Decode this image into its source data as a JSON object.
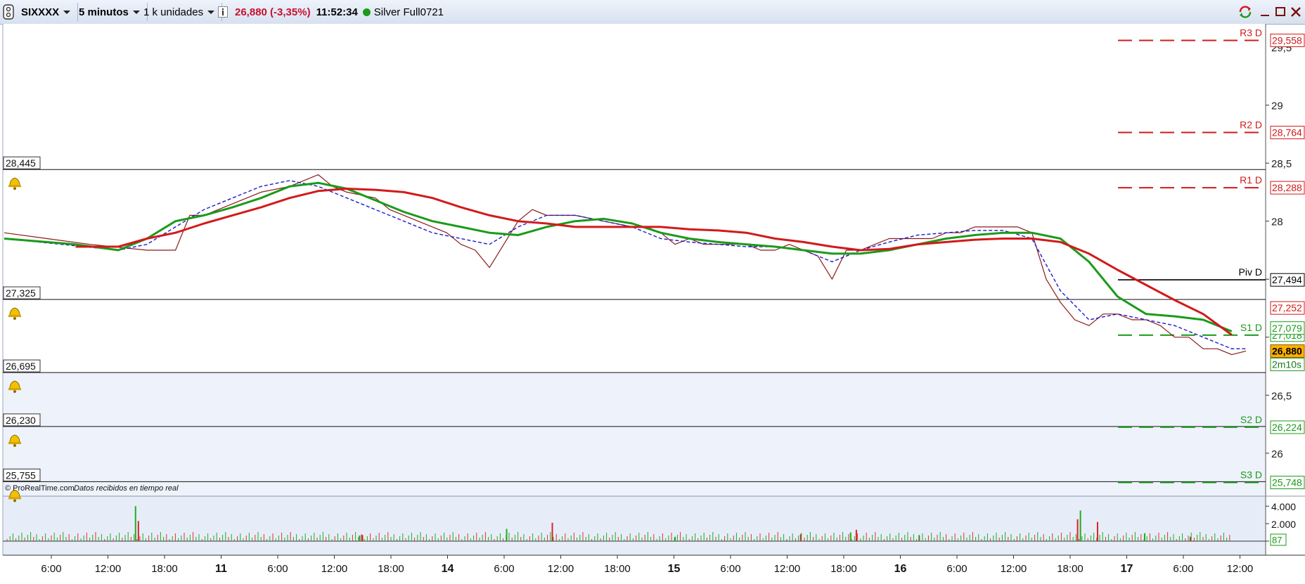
{
  "toolbar": {
    "symbol": "SIXXXX",
    "timeframe": "5 minutos",
    "units": "1 k unidades",
    "info_icon": "info-icon",
    "price_change": "26,880 (-3,35%)",
    "time": "11:52:34",
    "status_dot_color": "#1a9b1a",
    "feed": "Silver Full0721",
    "window_icons": [
      "refresh-icon",
      "minimize-icon",
      "maximize-icon",
      "close-icon"
    ]
  },
  "chart_data": {
    "type": "line",
    "credit": "© ProRealTime.com",
    "credit_note": "Datos recibidos en tiempo real",
    "y_axis": {
      "ticks": [
        26,
        26.5,
        27,
        27.5,
        28,
        28.5,
        29
      ],
      "tick_labels": [
        "26",
        "26,5",
        "27",
        "27,5",
        "28",
        "28,5",
        "29"
      ],
      "top_label": "29,5"
    },
    "x_axis": {
      "labels": [
        "6:00",
        "12:00",
        "18:00",
        "11",
        "6:00",
        "12:00",
        "18:00",
        "14",
        "6:00",
        "12:00",
        "18:00",
        "15",
        "6:00",
        "12:00",
        "18:00",
        "16",
        "6:00",
        "12:00",
        "18:00",
        "17",
        "6:00",
        "12:00"
      ],
      "bold": [
        false,
        false,
        false,
        true,
        false,
        false,
        false,
        true,
        false,
        false,
        false,
        true,
        false,
        false,
        false,
        true,
        false,
        false,
        false,
        true,
        false,
        false
      ]
    },
    "alert_levels": [
      {
        "label": "28,445",
        "value": 28.445
      },
      {
        "label": "27,325",
        "value": 27.325
      },
      {
        "label": "26,695",
        "value": 26.695
      },
      {
        "label": "26,230",
        "value": 26.23
      },
      {
        "label": "25,755",
        "value": 25.755
      }
    ],
    "pivots": [
      {
        "name": "R3 D",
        "tag": "29,558",
        "value": 29.558,
        "color": "#d21a1a",
        "style": "dashed"
      },
      {
        "name": "R2 D",
        "tag": "28,764",
        "value": 28.764,
        "color": "#d21a1a",
        "style": "dashed"
      },
      {
        "name": "R1 D",
        "tag": "28,288",
        "value": 28.288,
        "color": "#d21a1a",
        "style": "dashed"
      },
      {
        "name": "Piv D",
        "tag": "27,494",
        "value": 27.494,
        "color": "#000000",
        "style": "solid"
      },
      {
        "name": "S1 D",
        "tag": "27,018",
        "value": 27.018,
        "color": "#1a9b1a",
        "style": "dashed"
      },
      {
        "name": "S2 D",
        "tag": "26,224",
        "value": 26.224,
        "color": "#1a9b1a",
        "style": "dashed"
      },
      {
        "name": "S3 D",
        "tag": "25,748",
        "value": 25.748,
        "color": "#1a9b1a",
        "style": "dashed"
      }
    ],
    "axis_tags": [
      {
        "text": "27,252",
        "value": 27.252,
        "color": "#d21a1a"
      },
      {
        "text": "27,079",
        "value": 27.079,
        "color": "#1a9b1a"
      }
    ],
    "last_price": {
      "text": "26,880",
      "value": 26.88,
      "countdown": "2m10s"
    },
    "series": [
      {
        "key": "price",
        "color": "#8b1a1a",
        "x": [
          0,
          3,
          6,
          10,
          12,
          13,
          14,
          16,
          17,
          18,
          20,
          21,
          22,
          23,
          24,
          26,
          27,
          28,
          30,
          31,
          32,
          33,
          34,
          36,
          37,
          38,
          39,
          40,
          42,
          44,
          45,
          46,
          47,
          48,
          49,
          50,
          51,
          52,
          53,
          54,
          55,
          56,
          57,
          58,
          59,
          60,
          61,
          62,
          63,
          64,
          65,
          66,
          67,
          68,
          69,
          70,
          71,
          72,
          73,
          74,
          75,
          76,
          77,
          78,
          79,
          80,
          81,
          82,
          83,
          84,
          85,
          86,
          87
        ],
        "y": [
          27.9,
          27.85,
          27.8,
          27.75,
          27.75,
          28.05,
          28.05,
          28.15,
          28.2,
          28.25,
          28.3,
          28.35,
          28.4,
          28.3,
          28.25,
          28.2,
          28.1,
          28.05,
          27.95,
          27.9,
          27.8,
          27.75,
          27.6,
          28.0,
          28.1,
          28.05,
          28.05,
          28.05,
          28.0,
          27.95,
          27.95,
          27.9,
          27.8,
          27.85,
          27.8,
          27.8,
          27.8,
          27.8,
          27.75,
          27.75,
          27.8,
          27.75,
          27.7,
          27.5,
          27.75,
          27.75,
          27.8,
          27.85,
          27.85,
          27.85,
          27.85,
          27.9,
          27.9,
          27.95,
          27.95,
          27.95,
          27.95,
          27.9,
          27.5,
          27.3,
          27.15,
          27.1,
          27.2,
          27.2,
          27.15,
          27.15,
          27.1,
          27.0,
          27.0,
          26.9,
          26.9,
          26.85,
          26.88
        ]
      },
      {
        "key": "ma-fast",
        "color": "#1a1acc",
        "x": [
          0,
          4,
          8,
          10,
          12,
          14,
          16,
          18,
          20,
          22,
          24,
          26,
          28,
          30,
          32,
          34,
          36,
          38,
          40,
          42,
          44,
          46,
          48,
          50,
          52,
          54,
          56,
          58,
          60,
          62,
          64,
          66,
          68,
          70,
          72,
          74,
          76,
          78,
          80,
          82,
          84,
          86,
          87
        ],
        "y": [
          27.85,
          27.8,
          27.75,
          27.8,
          27.95,
          28.1,
          28.2,
          28.3,
          28.35,
          28.3,
          28.2,
          28.1,
          28.0,
          27.9,
          27.85,
          27.8,
          27.95,
          28.05,
          28.05,
          28.0,
          27.95,
          27.85,
          27.82,
          27.8,
          27.78,
          27.78,
          27.75,
          27.65,
          27.75,
          27.82,
          27.88,
          27.9,
          27.92,
          27.92,
          27.85,
          27.4,
          27.15,
          27.2,
          27.15,
          27.1,
          27.0,
          26.9,
          26.9
        ]
      },
      {
        "key": "ma-mid",
        "color": "#1a9b1a",
        "x": [
          0,
          5,
          8,
          10,
          12,
          14,
          16,
          18,
          20,
          22,
          24,
          26,
          28,
          30,
          32,
          34,
          36,
          38,
          40,
          42,
          44,
          46,
          48,
          50,
          52,
          54,
          56,
          58,
          60,
          62,
          64,
          66,
          68,
          70,
          72,
          74,
          76,
          78,
          80,
          82,
          84,
          86
        ],
        "y": [
          27.85,
          27.8,
          27.75,
          27.85,
          28.0,
          28.05,
          28.12,
          28.2,
          28.3,
          28.33,
          28.28,
          28.18,
          28.08,
          28.0,
          27.95,
          27.9,
          27.88,
          27.95,
          28.0,
          28.02,
          27.98,
          27.9,
          27.85,
          27.82,
          27.8,
          27.78,
          27.75,
          27.72,
          27.72,
          27.75,
          27.8,
          27.85,
          27.88,
          27.9,
          27.9,
          27.85,
          27.65,
          27.35,
          27.2,
          27.18,
          27.15,
          27.05
        ]
      },
      {
        "key": "ma-slow",
        "color": "#d21a1a",
        "x": [
          5,
          8,
          10,
          12,
          14,
          16,
          18,
          20,
          22,
          24,
          26,
          28,
          30,
          32,
          34,
          36,
          38,
          40,
          42,
          44,
          46,
          48,
          50,
          52,
          54,
          56,
          58,
          60,
          62,
          64,
          66,
          68,
          70,
          72,
          74,
          76,
          78,
          80,
          82,
          84,
          86
        ],
        "y": [
          27.78,
          27.78,
          27.85,
          27.9,
          27.98,
          28.05,
          28.12,
          28.2,
          28.26,
          28.28,
          28.27,
          28.25,
          28.2,
          28.12,
          28.05,
          28.0,
          27.98,
          27.95,
          27.95,
          27.95,
          27.95,
          27.93,
          27.92,
          27.9,
          27.85,
          27.82,
          27.78,
          27.75,
          27.76,
          27.8,
          27.82,
          27.84,
          27.85,
          27.85,
          27.82,
          27.72,
          27.58,
          27.45,
          27.32,
          27.2,
          27.02
        ]
      }
    ],
    "volume": {
      "y_ticks": [
        0,
        2000,
        4000
      ],
      "y_labels": [
        "0",
        "2.000",
        "4.000"
      ],
      "last_tag": "87",
      "spike_x": [
        9.2,
        9.4,
        24.9,
        25.1,
        35.2,
        38.4,
        47.0,
        55.8,
        59.3,
        59.7,
        64.1,
        75.2,
        75.4,
        76.6,
        79.9,
        83.1
      ],
      "spike_v": [
        4000,
        2300,
        650,
        700,
        1400,
        2100,
        500,
        800,
        1000,
        1300,
        700,
        2500,
        3500,
        2200,
        900,
        500
      ]
    }
  }
}
